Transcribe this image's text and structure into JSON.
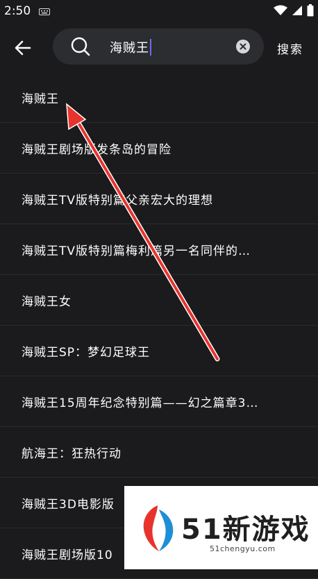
{
  "status": {
    "time": "2:50"
  },
  "search": {
    "query": "海贼王",
    "button_label": "搜索"
  },
  "results": [
    "海贼王",
    "海贼王剧场版发条岛的冒险",
    "海贼王TV版特别篇父亲宏大的理想",
    "海贼王TV版特别篇梅利篇另一名同伴的…",
    "海贼王女",
    "海贼王SP：梦幻足球王",
    "海贼王15周年纪念特别篇——幻之篇章3…",
    "航海王：狂热行动",
    "海贼王3D电影版",
    "海贼王剧场版10"
  ],
  "watermark": {
    "title": "51新游戏",
    "url": "51chengyu.com"
  },
  "colors": {
    "background": "#1b1b1d",
    "searchbox": "#2c2d31",
    "arrow": "#e8332d",
    "caret": "#6d6af2"
  }
}
